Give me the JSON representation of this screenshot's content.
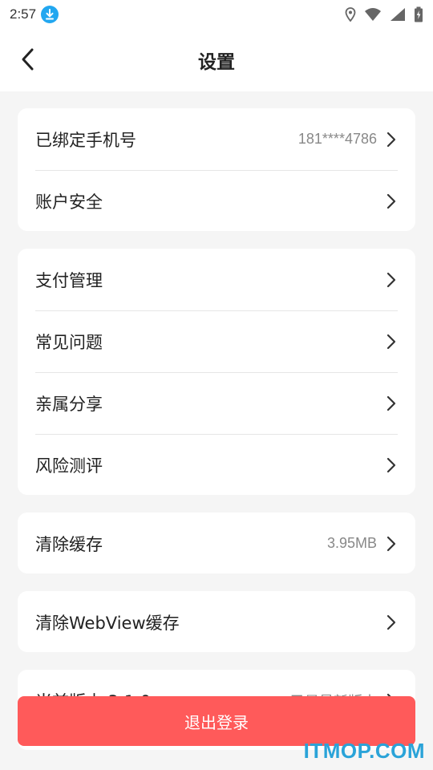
{
  "status_bar": {
    "time": "2:57"
  },
  "header": {
    "title": "设置"
  },
  "groups": [
    {
      "items": [
        {
          "label": "已绑定手机号",
          "value": "181****4786"
        },
        {
          "label": "账户安全"
        }
      ]
    },
    {
      "items": [
        {
          "label": "支付管理"
        },
        {
          "label": "常见问题"
        },
        {
          "label": "亲属分享"
        },
        {
          "label": "风险测评"
        }
      ]
    },
    {
      "items": [
        {
          "label": "清除缓存",
          "value": "3.95MB"
        }
      ]
    },
    {
      "items": [
        {
          "label": "清除WebView缓存"
        }
      ]
    },
    {
      "items": [
        {
          "label": "当前版本 3.1.0",
          "value": "已是最新版本"
        }
      ]
    }
  ],
  "logout_button": {
    "label": "退出登录"
  },
  "watermark": "ITMOP.COM",
  "colors": {
    "accent": "#ff5a5a",
    "background": "#f5f5f5",
    "download_badge": "#22a7f0"
  }
}
